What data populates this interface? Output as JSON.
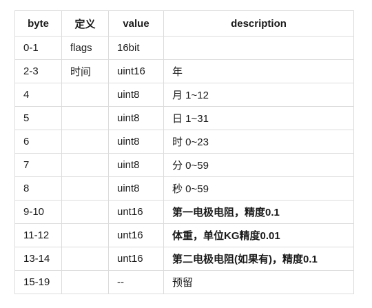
{
  "table": {
    "headers": [
      "byte",
      "定义",
      "value",
      "description"
    ],
    "rows": [
      {
        "byte": "0-1",
        "def": "flags",
        "value": "16bit",
        "desc": "",
        "bold": false
      },
      {
        "byte": "2-3",
        "def": "时间",
        "value": "uint16",
        "desc": "年",
        "bold": false
      },
      {
        "byte": "4",
        "def": "",
        "value": "uint8",
        "desc": "月 1~12",
        "bold": false
      },
      {
        "byte": "5",
        "def": "",
        "value": "uint8",
        "desc": "日 1~31",
        "bold": false
      },
      {
        "byte": "6",
        "def": "",
        "value": "uint8",
        "desc": "时 0~23",
        "bold": false
      },
      {
        "byte": "7",
        "def": "",
        "value": "uint8",
        "desc": "分 0~59",
        "bold": false
      },
      {
        "byte": "8",
        "def": "",
        "value": "uint8",
        "desc": "秒 0~59",
        "bold": false
      },
      {
        "byte": "9-10",
        "def": "",
        "value": "unt16",
        "desc": "第一电极电阻，精度0.1",
        "bold": true
      },
      {
        "byte": "11-12",
        "def": "",
        "value": "unt16",
        "desc": "体重，单位KG精度0.01",
        "bold": true
      },
      {
        "byte": "13-14",
        "def": "",
        "value": "unt16",
        "desc": "第二电极电阻(如果有)，精度0.1",
        "bold": true
      },
      {
        "byte": "15-19",
        "def": "",
        "value": "--",
        "desc": "预留",
        "bold": false
      }
    ]
  }
}
